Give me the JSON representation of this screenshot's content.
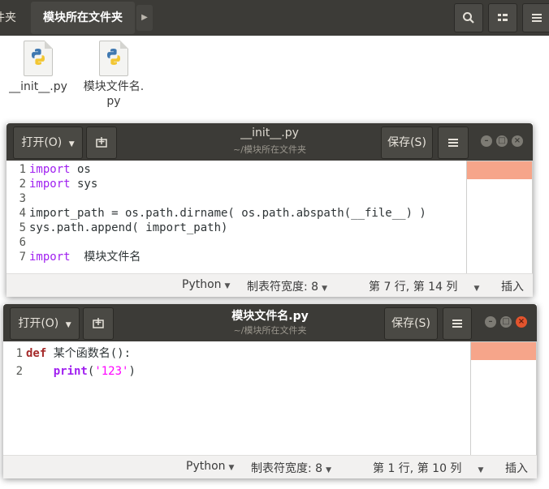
{
  "file_manager": {
    "tabs": [
      {
        "label": "件夹"
      },
      {
        "label": "模块所在文件夹"
      }
    ],
    "files": [
      {
        "name": "__init__.py"
      },
      {
        "name": "模块文件名.\npy"
      }
    ]
  },
  "window1": {
    "open_label": "打开(O)",
    "title": "__init__.py",
    "subtitle": "~/模块所在文件夹",
    "save_label": "保存(S)",
    "lines": [
      {
        "n": "1",
        "parts": [
          {
            "t": "import",
            "c": "kw-import"
          },
          {
            "t": " os"
          }
        ]
      },
      {
        "n": "2",
        "parts": [
          {
            "t": "import",
            "c": "kw-import"
          },
          {
            "t": " sys"
          }
        ]
      },
      {
        "n": "3",
        "parts": []
      },
      {
        "n": "4",
        "parts": [
          {
            "t": "import_path = os.path.dirname( os.path.abspath(__file__) )"
          }
        ]
      },
      {
        "n": "5",
        "parts": [
          {
            "t": "sys.path.append( import_path)"
          }
        ]
      },
      {
        "n": "6",
        "parts": []
      },
      {
        "n": "7",
        "parts": [
          {
            "t": "import",
            "c": "kw-import"
          },
          {
            "t": "  模块文件名"
          }
        ]
      }
    ],
    "status": {
      "language": "Python",
      "tab_width": "制表符宽度: 8",
      "position": "第 7 行, 第 14 列",
      "mode": "插入"
    }
  },
  "window2": {
    "open_label": "打开(O)",
    "title": "模块文件名.py",
    "subtitle": "~/模块所在文件夹",
    "save_label": "保存(S)",
    "lines": [
      {
        "n": "1",
        "parts": [
          {
            "t": "def",
            "c": "kw-def"
          },
          {
            "t": " 某个函数名():"
          }
        ]
      },
      {
        "n": "2",
        "parts": [
          {
            "t": "    "
          },
          {
            "t": "print",
            "c": "kw-print"
          },
          {
            "t": "("
          },
          {
            "t": "'123'",
            "c": "str"
          },
          {
            "t": ")"
          }
        ]
      }
    ],
    "status": {
      "language": "Python",
      "tab_width": "制表符宽度: 8",
      "position": "第 1 行, 第 10 列",
      "mode": "插入"
    }
  },
  "icons": {
    "search": "search-icon",
    "view": "view-grid-icon",
    "menu": "hamburger-menu-icon",
    "python": "python-logo-icon"
  },
  "colors": {
    "titlebar": "#3c3b37",
    "close": "#e3542d",
    "highlight": "#f6a58a",
    "keyword": "#a020f0"
  }
}
